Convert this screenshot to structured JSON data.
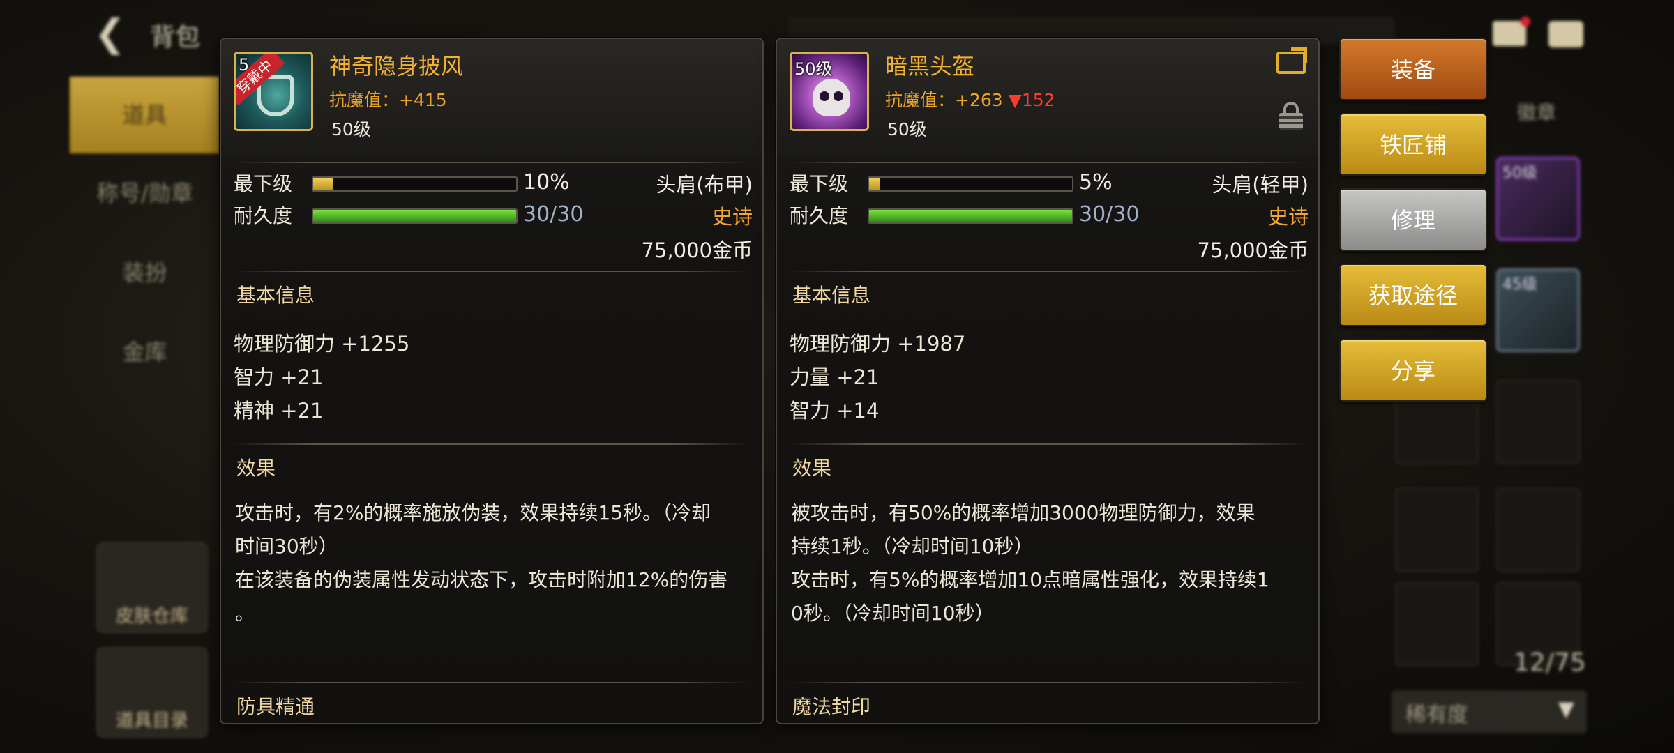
{
  "background": {
    "back_icon": "arrow-left-icon",
    "title": "背包",
    "sidebar": [
      "道具",
      "称号/勋章",
      "装扮",
      "金库"
    ],
    "tiles": [
      "皮肤仓库",
      "道具目录"
    ],
    "tab_label": "徽章",
    "grid_levels": [
      "50级",
      "45级"
    ],
    "count": "12/75",
    "sort_label": "稀有度",
    "sort_arrow": "▼"
  },
  "left_item": {
    "name": "神奇隐身披风",
    "wearing_badge": "穿戴中",
    "level_badge": "5",
    "icon": "cape-icon",
    "resist": "抗魔值：+415",
    "level": "50级",
    "min_level_label": "最下级",
    "min_level_pct": 10,
    "min_level_text": "10%",
    "durability_label": "耐久度",
    "durability_fraction": 1.0,
    "durability_text": "30/30",
    "slot": "头肩(布甲)",
    "rarity": "史诗",
    "price": "75,000金币",
    "basic_title": "基本信息",
    "stats": [
      "物理防御力 +1255",
      "智力 +21",
      "精神 +21"
    ],
    "effect_title": "效果",
    "effects": [
      "攻击时，有2%的概率施放伪装，效果持续15秒。（冷却",
      "时间30秒）",
      "在该装备的伪装属性发动状态下，攻击时附加12%的伤害",
      "。"
    ],
    "footer_title": "防具精通"
  },
  "right_item": {
    "name": "暗黑头盔",
    "level_badge": "50级",
    "icon": "skull-helmet-icon",
    "resist_prefix": "抗魔值：+263 ",
    "resist_delta": "▼152",
    "level": "50级",
    "min_level_label": "最下级",
    "min_level_pct": 5,
    "min_level_text": "5%",
    "durability_label": "耐久度",
    "durability_fraction": 1.0,
    "durability_text": "30/30",
    "slot": "头肩(轻甲)",
    "rarity": "史诗",
    "price": "75,000金币",
    "basic_title": "基本信息",
    "stats": [
      "物理防御力 +1987",
      "力量 +21",
      "智力 +14"
    ],
    "effect_title": "效果",
    "effects": [
      "被攻击时，有50%的概率增加3000物理防御力，效果",
      "持续1秒。（冷却时间10秒）",
      "攻击时，有5%的概率增加10点暗属性强化，效果持续1",
      "0秒。（冷却时间10秒）"
    ],
    "footer_title": "魔法封印"
  },
  "buttons": {
    "equip": "装备",
    "smith": "铁匠铺",
    "repair": "修理",
    "source": "获取途径",
    "share": "分享"
  },
  "colors": {
    "item_name": "#f3b131",
    "epic": "#f3a531",
    "stat_decrease": "#ff3a30",
    "equip_button": "#c0621e",
    "gold_button": "#d4a62a",
    "repair_button": "#a8a8a6"
  }
}
